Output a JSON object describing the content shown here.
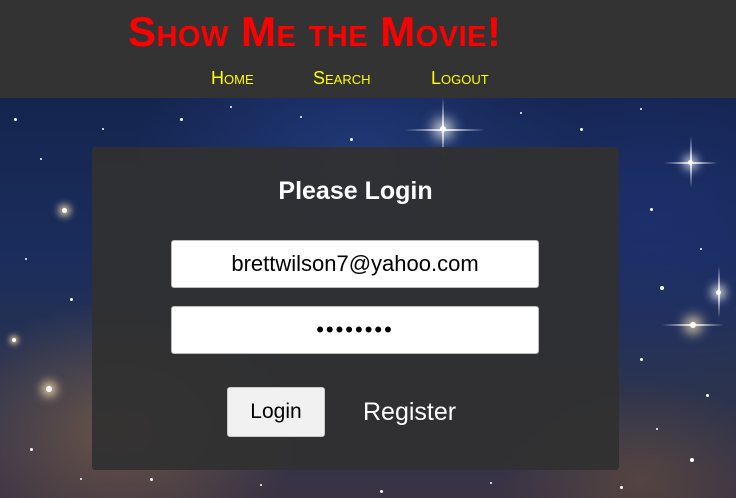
{
  "header": {
    "site_title": "Show Me the Movie!",
    "nav": [
      {
        "label": "Home"
      },
      {
        "label": "Search"
      },
      {
        "label": "Logout"
      }
    ]
  },
  "login": {
    "title": "Please Login",
    "email_value": "brettwilson7@yahoo.com",
    "password_value": "12345678",
    "login_button_label": "Login",
    "register_label": "Register"
  },
  "colors": {
    "header_bg": "#333333",
    "title": "#ff0000",
    "nav_link": "#ffff00",
    "card_bg": "#303030"
  }
}
